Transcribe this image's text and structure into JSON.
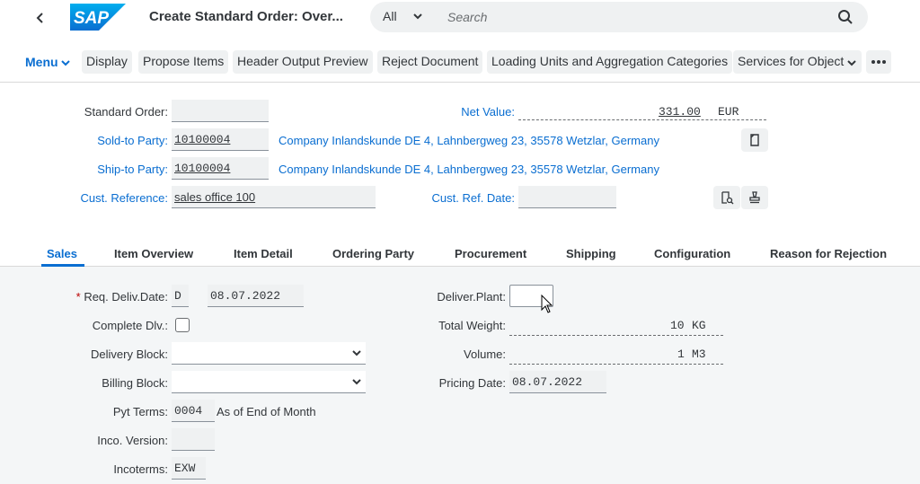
{
  "shell": {
    "title": "Create Standard Order: Over...",
    "logo_text": "SAP",
    "search_scope": "All",
    "search_placeholder": "Search"
  },
  "toolbar": {
    "menu_label": "Menu",
    "buttons": [
      "Display",
      "Propose Items",
      "Header Output Preview",
      "Reject Document",
      "Loading Units and Aggregation Categories",
      "Services for Object"
    ]
  },
  "header": {
    "standard_order_label": "Standard Order:",
    "standard_order_value": "",
    "net_value_label": "Net Value:",
    "net_value": "331.00",
    "currency": "EUR",
    "sold_to_label": "Sold-to Party:",
    "sold_to_value": "10100004",
    "sold_to_address": "Company Inlandskunde DE 4, Lahnbergweg 23, 35578 Wetzlar, Germany",
    "ship_to_label": "Ship-to Party:",
    "ship_to_value": "10100004",
    "ship_to_address": "Company Inlandskunde DE 4, Lahnbergweg 23, 35578 Wetzlar, Germany",
    "cust_ref_label": "Cust. Reference:",
    "cust_ref_value": "sales office 100",
    "cust_ref_date_label": "Cust. Ref. Date:",
    "cust_ref_date_value": ""
  },
  "tabs": [
    "Sales",
    "Item Overview",
    "Item Detail",
    "Ordering Party",
    "Procurement",
    "Shipping",
    "Configuration",
    "Reason for Rejection"
  ],
  "sales": {
    "req_deliv_label": "Req. Deliv.Date:",
    "req_star": "*",
    "req_deliv_type": "D",
    "req_deliv_date": "08.07.2022",
    "complete_dlv_label": "Complete Dlv.:",
    "delivery_block_label": "Delivery Block:",
    "delivery_block_value": "",
    "billing_block_label": "Billing Block:",
    "billing_block_value": "",
    "pyt_terms_label": "Pyt Terms:",
    "pyt_terms_value": "0004",
    "pyt_terms_text": "As of End of Month",
    "inco_version_label": "Inco. Version:",
    "inco_version_value": "",
    "incoterms_label": "Incoterms:",
    "incoterms_value": "EXW",
    "deliver_plant_label": "Deliver.Plant:",
    "deliver_plant_value": "",
    "total_weight_label": "Total Weight:",
    "total_weight_value": "10",
    "total_weight_unit": "KG",
    "volume_label": "Volume:",
    "volume_value": "1",
    "volume_unit": "M3",
    "pricing_date_label": "Pricing Date:",
    "pricing_date_value": "08.07.2022"
  },
  "colors": {
    "accent": "#0a6ed1",
    "shell_bg": "#ffffff",
    "content_bg": "#f4f6f7",
    "required": "#bb0000"
  }
}
